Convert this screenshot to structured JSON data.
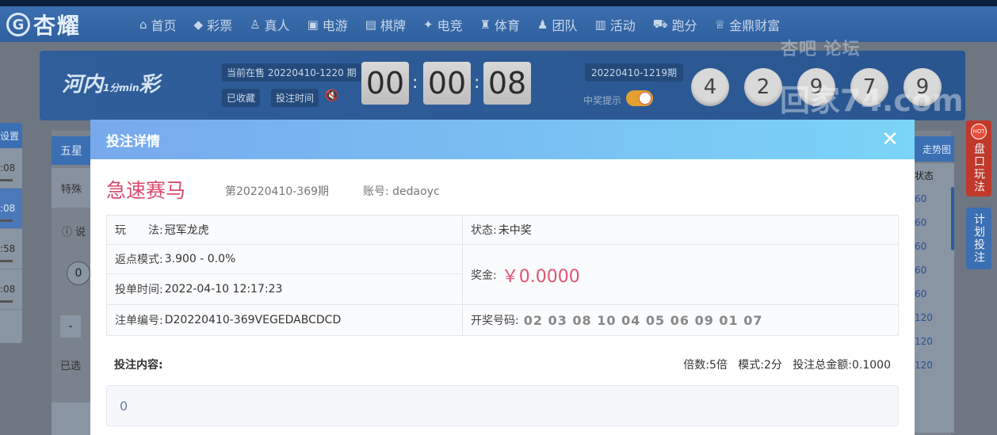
{
  "brand": {
    "name": "杏耀",
    "logo_letter": "G"
  },
  "nav": {
    "items": [
      {
        "label": "首页",
        "icon": "home-icon",
        "glyph": "⌂"
      },
      {
        "label": "彩票",
        "icon": "lottery-icon",
        "glyph": "◆"
      },
      {
        "label": "真人",
        "icon": "live-dealer-icon",
        "glyph": "♙"
      },
      {
        "label": "电游",
        "icon": "slot-icon",
        "glyph": "▣"
      },
      {
        "label": "棋牌",
        "icon": "cards-icon",
        "glyph": "▤"
      },
      {
        "label": "电竞",
        "icon": "gamepad-icon",
        "glyph": "✦"
      },
      {
        "label": "体育",
        "icon": "trophy-icon",
        "glyph": "♜"
      },
      {
        "label": "团队",
        "icon": "team-icon",
        "glyph": "♟"
      },
      {
        "label": "活动",
        "icon": "gift-icon",
        "glyph": "▥"
      },
      {
        "label": "跑分",
        "icon": "car-icon",
        "glyph": "⛟"
      },
      {
        "label": "金鼎财富",
        "icon": "wealth-icon",
        "glyph": "♕"
      }
    ]
  },
  "lottery_header": {
    "logo_text": "河内",
    "logo_sub": "1分min",
    "logo_suffix": "彩",
    "on_sale": "当前在售 20220410-1220 期",
    "favorited_label": "已收藏",
    "bet_time_label": "投注时间",
    "countdown": {
      "h": "00",
      "m": "00",
      "s": "08"
    },
    "last_issue": "20220410-1219期",
    "win_hint_label": "中奖提示",
    "win_hint_on": true,
    "balls": [
      "4",
      "2",
      "9",
      "7",
      "9"
    ]
  },
  "left_panel": {
    "header": "设置",
    "rows": [
      ":08",
      ":08",
      ":58",
      ":08"
    ]
  },
  "main": {
    "tab_five": "五星",
    "special_label": "特殊",
    "desc_prefix": "说",
    "zero": "0",
    "minus": "-",
    "selected_prefix": "已选"
  },
  "right_panel": {
    "header": "走势图",
    "col_header": "状态",
    "values": [
      "60",
      "60",
      "60",
      "60",
      "60",
      "120",
      "120",
      "120"
    ],
    "side_red": {
      "hot": "HOT",
      "label": "盘口玩法"
    },
    "side_blue": {
      "label": "计划投注"
    }
  },
  "watermark": {
    "line1": "杏吧 论坛",
    "line2": "回家74.com"
  },
  "modal": {
    "title": "投注详情",
    "close": "✕",
    "lottery_name": "急速赛马",
    "issue": "第20220410-369期",
    "account_label": "账号:",
    "account": "dedaoyc",
    "play_label": "玩　　法:",
    "play_value": "冠军龙虎",
    "status_label": "状态:",
    "status_value": "未中奖",
    "rebate_label": "返点模式:",
    "rebate_value": "3.900 - 0.0%",
    "prize_label": "奖金:",
    "prize_value": "￥0.0000",
    "bet_time_label": "投单时间:",
    "bet_time_value": "2022-04-10 12:17:23",
    "order_label": "注单编号:",
    "order_value": "D20220410-369VEGEDABCDCD",
    "draw_label": "开奖号码:",
    "draw_value": "02 03 08 10 04 05 06 09 01 07",
    "content_label": "投注内容:",
    "multiplier_label": "倍数:",
    "multiplier_value": "5倍",
    "mode_label": "模式:",
    "mode_value": "2分",
    "total_label": "投注总金额:",
    "total_value": "0.1000",
    "content_value": "0"
  }
}
